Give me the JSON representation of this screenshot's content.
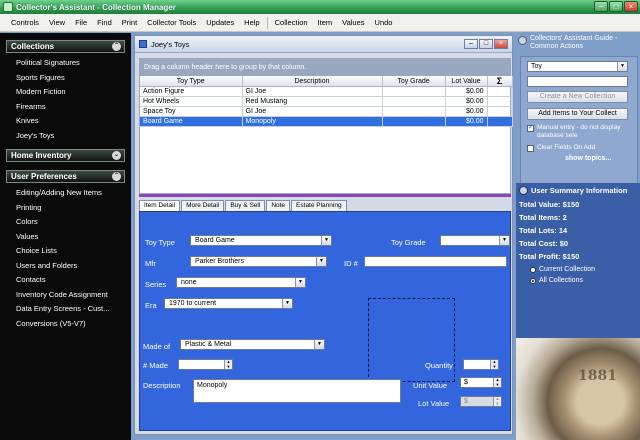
{
  "window": {
    "title": "Collector's Assistant - Collection Manager",
    "minimize": "–",
    "maximize": "□",
    "close": "×"
  },
  "menu": [
    "Controls",
    "View",
    "File",
    "Find",
    "Print",
    "Collector Tools",
    "Updates",
    "Help",
    "Collection",
    "Item",
    "Values",
    "Undo"
  ],
  "sidebar": {
    "collections": {
      "title": "Collections",
      "items": [
        "Political Signatures",
        "Sports Figures",
        "Modern Fiction",
        "Firearms",
        "Knives",
        "Joey's Toys"
      ]
    },
    "home_inventory": {
      "title": "Home Inventory"
    },
    "user_prefs": {
      "title": "User Preferences",
      "items": [
        "Editing/Adding New Items",
        "Printing",
        "Colors",
        "Values",
        "Choice Lists",
        "Users and Folders",
        "Contacts",
        "Inventory Code Assignment",
        "Data Entry Screens - Cust...",
        "Conversions (V5-V7)"
      ]
    }
  },
  "child_window": {
    "title": "Joey's Toys"
  },
  "grid": {
    "group_hint": "Drag a column header here to group by that column.",
    "columns": [
      "Toy Type",
      "Description",
      "Toy Grade",
      "Lot Value",
      "Σ"
    ],
    "rows": [
      [
        "Action Figure",
        "GI Joe",
        "",
        "$0.00"
      ],
      [
        "Hot Wheels",
        "Red Mustang",
        "",
        "$0.00"
      ],
      [
        "Space Toy",
        "GI Joe",
        "",
        "$0.00"
      ],
      [
        "Board Game",
        "Monopoly",
        "",
        "$0.00"
      ]
    ],
    "selected_row": 3
  },
  "tabs": [
    "Item Detail",
    "More Detail",
    "Buy & Sell",
    "Note",
    "Estate Planning"
  ],
  "detail": {
    "toy_type_label": "Toy Type",
    "toy_type_value": "Board Game",
    "toy_grade_label": "Toy Grade",
    "toy_grade_value": "",
    "mfr_label": "Mfr",
    "mfr_value": "Parker Brothers",
    "id_label": "ID #",
    "id_value": "",
    "series_label": "Series",
    "series_value": "none",
    "era_label": "Era",
    "era_value": "1970 to current",
    "made_of_label": "Made of",
    "made_of_value": "Plastic & Metal",
    "num_made_label": "# Made",
    "num_made_value": "",
    "quantity_label": "Quantity",
    "quantity_value": "",
    "description_label": "Description",
    "description_value": "Monopoly",
    "unit_value_label": "Unit Value",
    "unit_value_value": "$",
    "lot_value_label": "Lot Value",
    "lot_value_value": "$"
  },
  "right_panel": {
    "header": "Collectors' Assistant Guide - Common Actions",
    "collection_select": "Toy",
    "create_button": "Create a New Collection",
    "add_button": "Add Items to Your Collect",
    "manual_entry": "Manual entry - do not display database sele",
    "clear_fields": "Clear Fields On Add",
    "show_topics": "show topics..."
  },
  "summary": {
    "title": "User Summary Information",
    "total_value": "Total Value: $150",
    "total_items": "Total Items: 2",
    "total_lots": "Total Lots: 14",
    "total_cost": "Total Cost: $0",
    "total_profit": "Total Profit: $150",
    "radio_current": "Current Collection",
    "radio_all": "All Collections"
  },
  "decor": {
    "coin_year": "1881"
  }
}
